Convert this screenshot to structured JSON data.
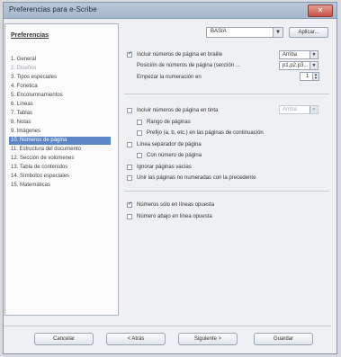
{
  "window": {
    "title": "Preferencias para e-Scribe"
  },
  "sidebar": {
    "heading": "Preferencias",
    "items": [
      {
        "label": "1. General",
        "state": "normal"
      },
      {
        "label": "2. Diseños",
        "state": "disabled"
      },
      {
        "label": "3. Tipos especiales",
        "state": "normal"
      },
      {
        "label": "4. Fonetica",
        "state": "normal"
      },
      {
        "label": "5. Encolumnamientos",
        "state": "normal"
      },
      {
        "label": "6. Líneas",
        "state": "normal"
      },
      {
        "label": "7. Tablas",
        "state": "normal"
      },
      {
        "label": "8. Notas",
        "state": "normal"
      },
      {
        "label": "9. Imágenes",
        "state": "normal"
      },
      {
        "label": "10. Números de página",
        "state": "selected"
      },
      {
        "label": "11. Estructura del documento",
        "state": "normal"
      },
      {
        "label": "12. Sección de volúmenes",
        "state": "normal"
      },
      {
        "label": "13. Tabla de contenidos",
        "state": "normal"
      },
      {
        "label": "14. Símbolos especiales",
        "state": "normal"
      },
      {
        "label": "15. Matemáticas",
        "state": "normal"
      }
    ]
  },
  "toolbar": {
    "style_value": "BASIA",
    "apply_label": "Aplicar..."
  },
  "options": {
    "include_top": {
      "label": "Incluir números de página en braille",
      "checked": true,
      "value": "Arriba"
    },
    "position": {
      "label": "Posición de números de página (sección ...",
      "value": "p1,p2,p3..."
    },
    "start_numbering": {
      "label": "Empezar la numeración en",
      "value": "1"
    },
    "include_ink": {
      "label": "Incluir números de página en tinta",
      "checked": false,
      "value": "Arriba"
    },
    "page_range": {
      "label": "Rango de páginas",
      "checked": false
    },
    "prefix": {
      "label": "Prefijo (a, b, etc.) en las páginas de continuación",
      "checked": false
    },
    "page_separator": {
      "label": "Línea separador de página",
      "checked": false
    },
    "with_number": {
      "label": "Con número de página",
      "checked": false
    },
    "ignore_empty": {
      "label": "Ignorar páginas vacías",
      "checked": false
    },
    "join_unnumbered": {
      "label": "Unir las páginas no numeradas con la precedente",
      "checked": false
    },
    "odd_only": {
      "label": "Números sólo en líneas opuesta",
      "checked": true
    },
    "bottom_line": {
      "label": "Número abajo en línea opuesta",
      "checked": false
    }
  },
  "footer": {
    "cancel": "Cancelar",
    "back": "< Atrás",
    "next": "Siguiente >",
    "save": "Guardar"
  }
}
